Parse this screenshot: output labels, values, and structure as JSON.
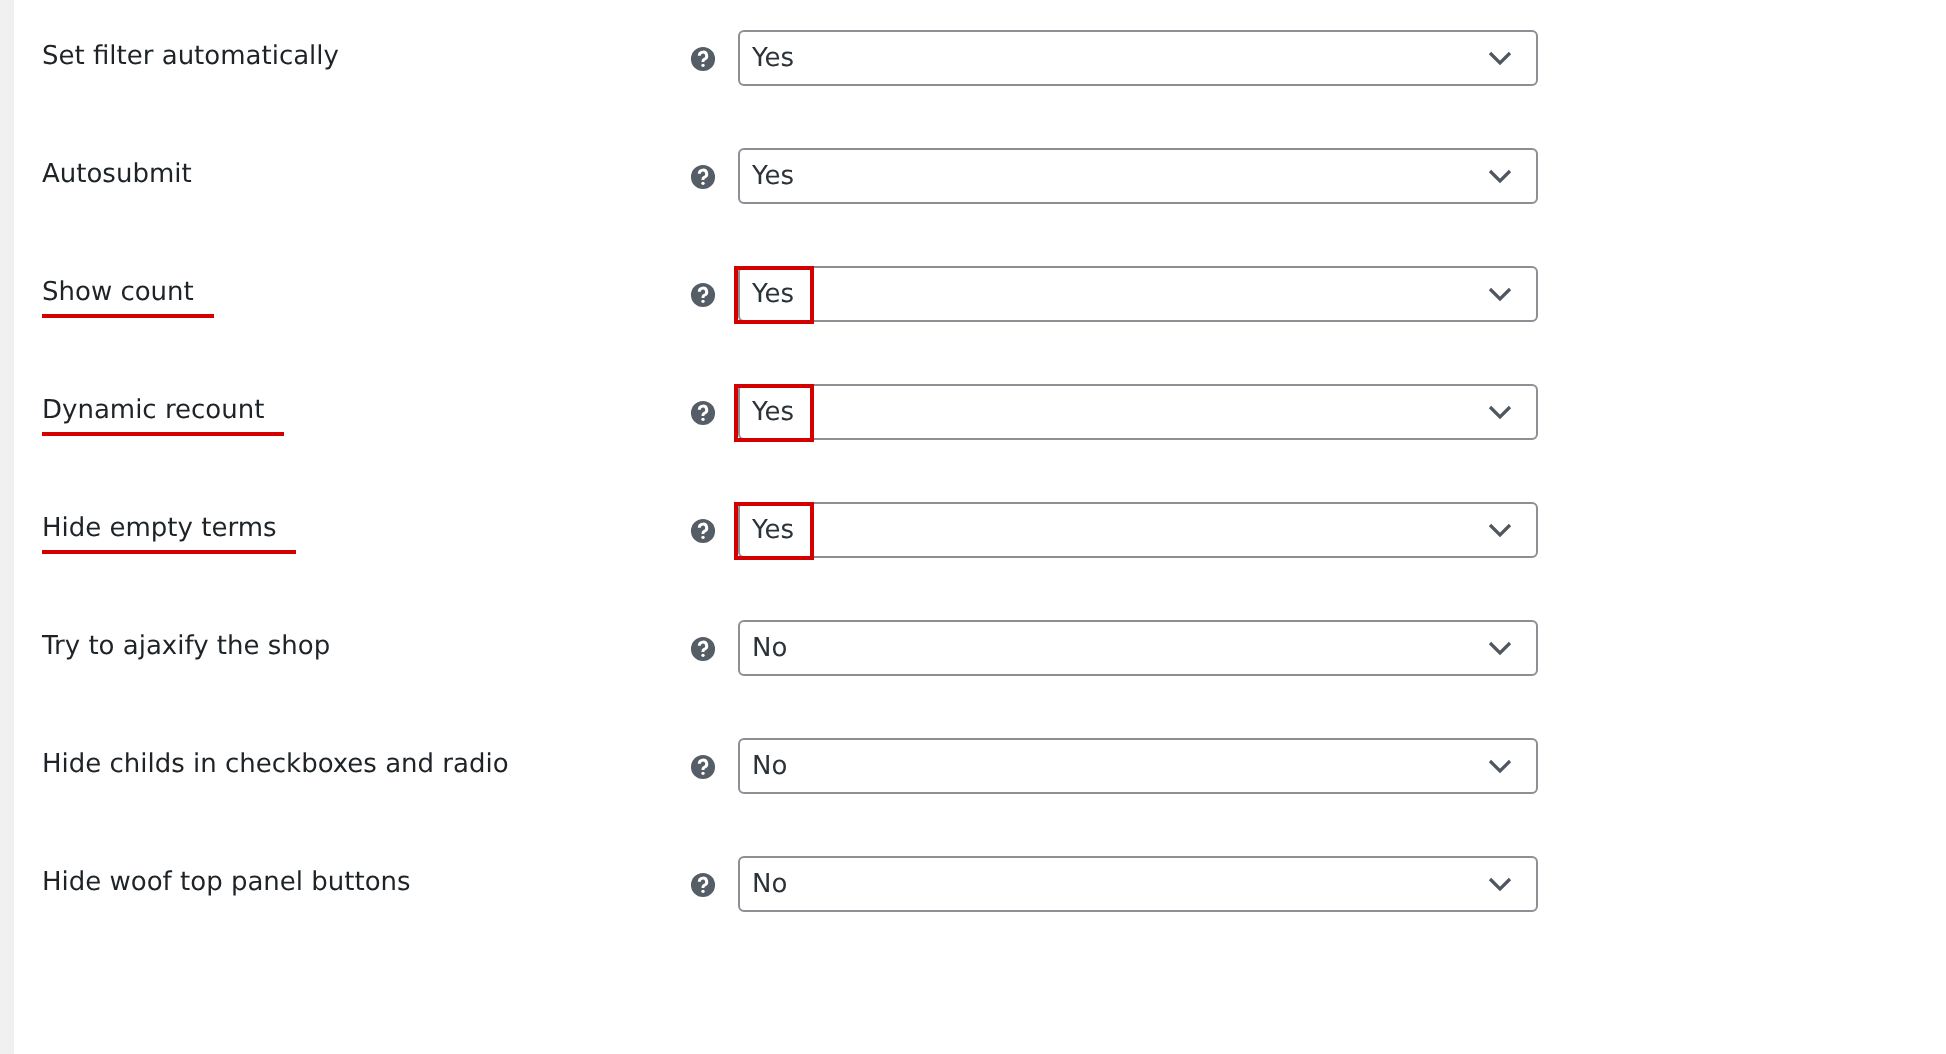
{
  "settings": [
    {
      "label": "Set filter automatically",
      "value": "Yes",
      "highlighted": false
    },
    {
      "label": "Autosubmit",
      "value": "Yes",
      "highlighted": false
    },
    {
      "label": "Show count",
      "value": "Yes",
      "highlighted": true
    },
    {
      "label": "Dynamic recount",
      "value": "Yes",
      "highlighted": true
    },
    {
      "label": "Hide empty terms",
      "value": "Yes",
      "highlighted": true
    },
    {
      "label": "Try to ajaxify the shop",
      "value": "No",
      "highlighted": false
    },
    {
      "label": "Hide childs in checkboxes and radio",
      "value": "No",
      "highlighted": false
    },
    {
      "label": "Hide woof top panel buttons",
      "value": "No",
      "highlighted": false
    }
  ]
}
